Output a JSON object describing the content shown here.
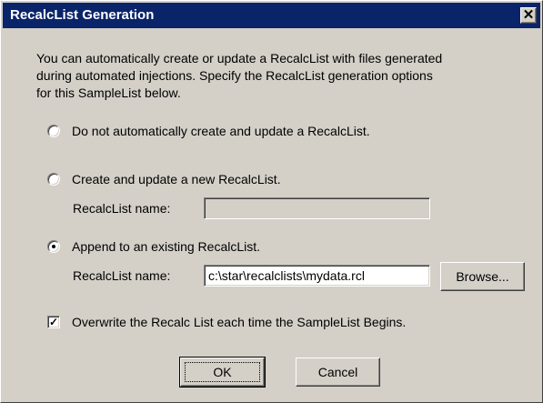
{
  "window": {
    "title": "RecalcList Generation",
    "close_glyph": "✕"
  },
  "description": {
    "line1": "You can automatically create or update a RecalcList with files generated",
    "line2": "during automated injections.  Specify the RecalcList generation options",
    "line3": "for this SampleList below."
  },
  "options": {
    "no_auto": {
      "label": "Do not automatically create and update a RecalcList.",
      "selected": false
    },
    "create_new": {
      "label": "Create and update a new RecalcList.",
      "selected": false,
      "field_label": "RecalcList name:",
      "value": "",
      "enabled": false
    },
    "append": {
      "label": "Append to an existing RecalcList.",
      "selected": true,
      "field_label": "RecalcList name:",
      "value": "c:\\star\\recalclists\\mydata.rcl",
      "browse_label": "Browse..."
    }
  },
  "overwrite": {
    "label": "Overwrite the Recalc List each time the SampleList Begins.",
    "checked": true,
    "check_glyph": "✓"
  },
  "buttons": {
    "ok_label": "OK",
    "cancel_label": "Cancel"
  }
}
